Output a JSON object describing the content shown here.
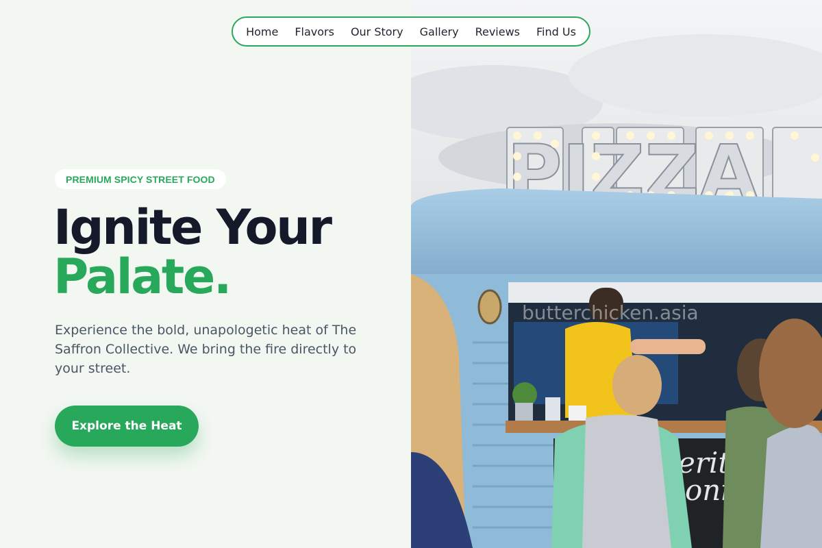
{
  "nav": {
    "items": [
      {
        "label": "Home"
      },
      {
        "label": "Flavors"
      },
      {
        "label": "Our Story"
      },
      {
        "label": "Gallery"
      },
      {
        "label": "Reviews"
      },
      {
        "label": "Find Us"
      }
    ]
  },
  "hero": {
    "badge": "PREMIUM SPICY STREET FOOD",
    "headline_line1": "Ignite Your",
    "headline_line2": "Palate.",
    "description": "Experience the bold, unapologetic heat of The Saffron Collective. We bring the fire directly to your street.",
    "cta_label": "Explore the Heat"
  },
  "photo": {
    "sign_text": "PIZZA",
    "watermark": "butterchicken.asia"
  },
  "colors": {
    "accent": "#27a85a",
    "heading": "#141a2a",
    "background": "#f2f7f1",
    "truck_blue": "#8fbad8"
  }
}
